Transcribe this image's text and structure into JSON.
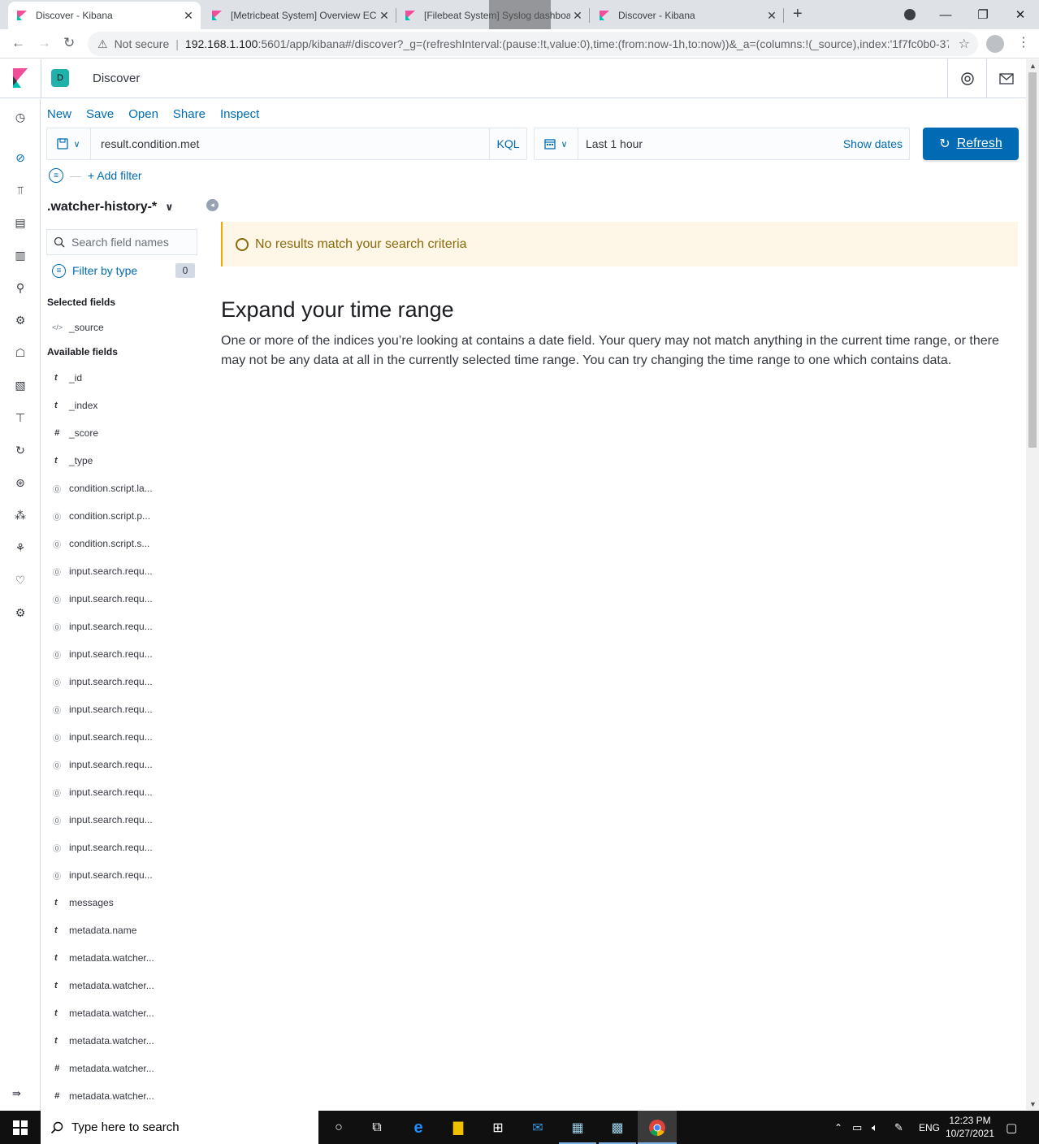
{
  "browser": {
    "tabs": [
      {
        "title": "Discover - Kibana",
        "active": true
      },
      {
        "title": "[Metricbeat System] Overview EC",
        "active": false
      },
      {
        "title": "[Filebeat System] Syslog dashboard",
        "active": false
      },
      {
        "title": "Discover - Kibana",
        "active": false
      }
    ],
    "not_secure": "Not secure",
    "url_host": "192.168.1.100",
    "url_rest": ":5601/app/kibana#/discover?_g=(refreshInterval:(pause:!t,value:0),time:(from:now-1h,to:now))&_a=(columns:!(_source),index:'1f7fc0b0-37..."
  },
  "kibana": {
    "space_initial": "D",
    "app_title": "Discover",
    "top_menu": [
      "New",
      "Save",
      "Open",
      "Share",
      "Inspect"
    ],
    "query": {
      "value": "result.condition.met",
      "language": "KQL"
    },
    "time": {
      "range": "Last 1 hour",
      "show_dates": "Show dates",
      "refresh": "Refresh"
    },
    "add_filter": "+ Add filter",
    "sidebar": {
      "index_pattern": ".watcher-history-*",
      "search_placeholder": "Search field names",
      "filter_by_type": "Filter by type",
      "filter_count": "0",
      "selected_title": "Selected fields",
      "available_title": "Available fields",
      "selected_fields": [
        {
          "type": "source",
          "name": "_source"
        }
      ],
      "available_fields": [
        {
          "type": "t",
          "name": "_id"
        },
        {
          "type": "t",
          "name": "_index"
        },
        {
          "type": "#",
          "name": "_score"
        },
        {
          "type": "t",
          "name": "_type"
        },
        {
          "type": "?",
          "name": "condition.script.la..."
        },
        {
          "type": "?",
          "name": "condition.script.p..."
        },
        {
          "type": "?",
          "name": "condition.script.s..."
        },
        {
          "type": "?",
          "name": "input.search.requ..."
        },
        {
          "type": "?",
          "name": "input.search.requ..."
        },
        {
          "type": "?",
          "name": "input.search.requ..."
        },
        {
          "type": "?",
          "name": "input.search.requ..."
        },
        {
          "type": "?",
          "name": "input.search.requ..."
        },
        {
          "type": "?",
          "name": "input.search.requ..."
        },
        {
          "type": "?",
          "name": "input.search.requ..."
        },
        {
          "type": "?",
          "name": "input.search.requ..."
        },
        {
          "type": "?",
          "name": "input.search.requ..."
        },
        {
          "type": "?",
          "name": "input.search.requ..."
        },
        {
          "type": "?",
          "name": "input.search.requ..."
        },
        {
          "type": "?",
          "name": "input.search.requ..."
        },
        {
          "type": "t",
          "name": "messages"
        },
        {
          "type": "t",
          "name": "metadata.name"
        },
        {
          "type": "t",
          "name": "metadata.watcher..."
        },
        {
          "type": "t",
          "name": "metadata.watcher..."
        },
        {
          "type": "t",
          "name": "metadata.watcher..."
        },
        {
          "type": "t",
          "name": "metadata.watcher..."
        },
        {
          "type": "#",
          "name": "metadata.watcher..."
        },
        {
          "type": "#",
          "name": "metadata.watcher..."
        }
      ]
    },
    "callout": "No results match your search criteria",
    "expand_title": "Expand your time range",
    "expand_body": "One or more of the indices you’re looking at contains a date field. Your query may not match anything in the current time range, or there may not be any data at all in the currently selected time range. You can try changing the time range to one which contains data."
  },
  "taskbar": {
    "search_placeholder": "Type here to search",
    "lang": "ENG",
    "time": "12:23 PM",
    "date": "10/27/2021"
  },
  "colors": {
    "kibana_link": "#006bb4",
    "refresh_bg": "#006bb4",
    "callout_bg": "#fef6e6",
    "callout_border": "#f5a700",
    "space_avatar": "#20b2aa"
  }
}
